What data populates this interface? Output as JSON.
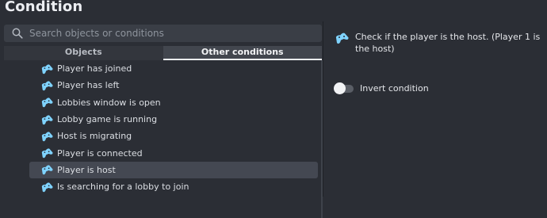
{
  "window": {
    "title": "Condition"
  },
  "search": {
    "placeholder": "Search objects or conditions"
  },
  "tabs": [
    {
      "label": "Objects",
      "active": false
    },
    {
      "label": "Other conditions",
      "active": true
    }
  ],
  "conditions": [
    {
      "label": "Player has joined",
      "icon": "gamepad-icon",
      "selected": false
    },
    {
      "label": "Player has left",
      "icon": "gamepad-icon",
      "selected": false
    },
    {
      "label": "Lobbies window is open",
      "icon": "gamepad-icon",
      "selected": false
    },
    {
      "label": "Lobby game is running",
      "icon": "gamepad-icon",
      "selected": false
    },
    {
      "label": "Host is migrating",
      "icon": "gamepad-icon",
      "selected": false
    },
    {
      "label": "Player is connected",
      "icon": "gamepad-icon",
      "selected": false
    },
    {
      "label": "Player is host",
      "icon": "gamepad-icon",
      "selected": true
    },
    {
      "label": "Is searching for a lobby to join",
      "icon": "gamepad-icon",
      "selected": false
    }
  ],
  "detail": {
    "icon": "gamepad-icon",
    "description": "Check if the player is the host. (Player 1 is the host)"
  },
  "invert": {
    "label": "Invert condition",
    "checked": false
  },
  "colors": {
    "background": "#2b2e35",
    "selected_row": "#444852",
    "icon_blue": "#7fd3ff",
    "text": "#dcdfe4"
  }
}
